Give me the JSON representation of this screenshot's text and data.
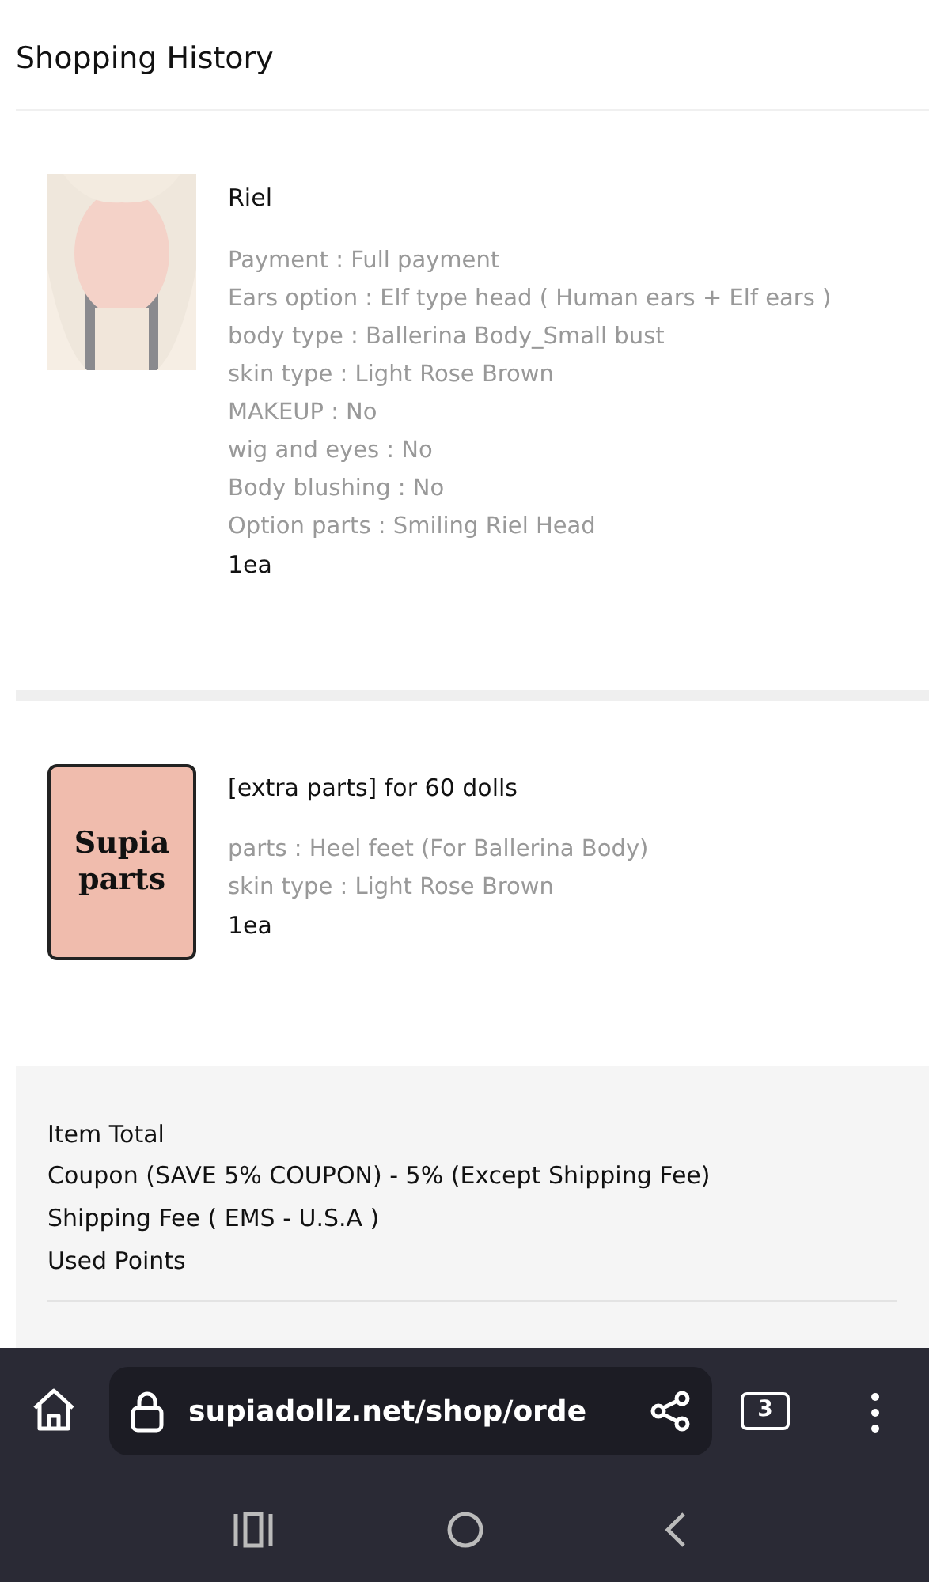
{
  "page_title": "Shopping History",
  "items": [
    {
      "name": "Riel",
      "options": [
        "Payment : Full payment",
        "Ears option : Elf type head ( Human ears + Elf ears )",
        "body type : Ballerina Body_Small bust",
        "skin type : Light Rose Brown",
        "MAKEUP : No",
        "wig and eyes : No",
        "Body blushing : No",
        "Option parts : Smiling Riel Head"
      ],
      "quantity": "1ea"
    },
    {
      "thumbnail": {
        "kind": "logo",
        "lines": [
          "Supia",
          "parts"
        ]
      },
      "name": "[extra parts] for 60 dolls",
      "options": [
        "parts : Heel feet (For Ballerina Body)",
        "skin type : Light Rose Brown"
      ],
      "quantity": "1ea"
    }
  ],
  "summary": [
    "Item Total",
    "Coupon (SAVE 5% COUPON) - 5% (Except Shipping Fee)",
    "Shipping Fee ( EMS - U.S.A )",
    "Used Points"
  ],
  "browser": {
    "url": "supiadollz.net/shop/orde",
    "tab_count": "3"
  }
}
